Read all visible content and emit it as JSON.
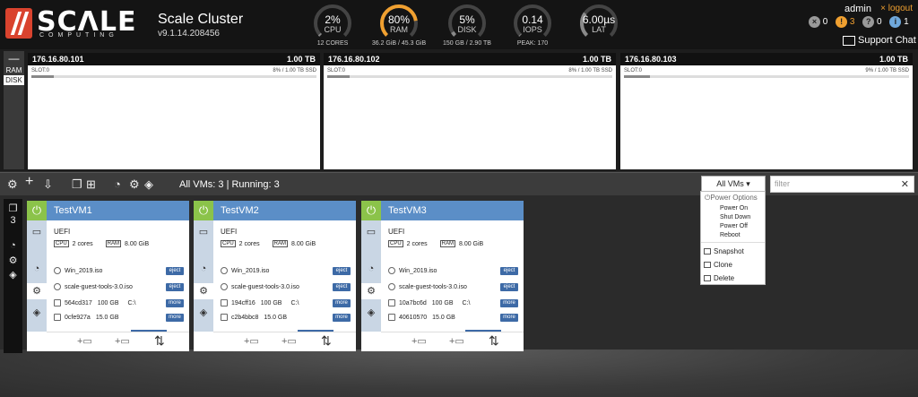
{
  "brand": {
    "word": "SCΛLE",
    "sub": "COMPUTING"
  },
  "cluster": {
    "name": "Scale Cluster",
    "version": "v9.1.14.208456"
  },
  "gauges": [
    {
      "value": "2%",
      "label": "CPU",
      "sub": "12 CORES",
      "fill": 0.02,
      "color": "#8a8a8a"
    },
    {
      "value": "80%",
      "label": "RAM",
      "sub": "36.2 GiB / 45.3 GiB",
      "fill": 0.8,
      "color": "#f0a030"
    },
    {
      "value": "5%",
      "label": "DISK",
      "sub": "150 GB / 2.90 TB",
      "fill": 0.05,
      "color": "#8a8a8a"
    },
    {
      "value": "0.14",
      "label": "IOPS",
      "sub": "PEAK: 170",
      "fill": 0.01,
      "color": "#8a8a8a"
    },
    {
      "value": "6.00µs",
      "label": "LAT",
      "sub": "",
      "fill": 0.3,
      "color": "#8a8a8a"
    }
  ],
  "user": {
    "name": "admin",
    "logout": "× logout"
  },
  "alerts": [
    {
      "icon": "error-icon",
      "count": "0",
      "color": "#999",
      "glyph": "×"
    },
    {
      "icon": "warning-icon",
      "count": "3",
      "color": "#f0a030",
      "glyph": "!"
    },
    {
      "icon": "question-icon",
      "count": "0",
      "color": "#999",
      "glyph": "?"
    },
    {
      "icon": "info-icon",
      "count": "1",
      "color": "#6fa8dc",
      "glyph": "i"
    }
  ],
  "support": "Support Chat",
  "rd": {
    "minimize": "—",
    "ram": "RAM",
    "disk": "DISK"
  },
  "nodes": [
    {
      "ip": "176.16.80.101",
      "capacity": "1.00 TB",
      "slot": "SLOT:0",
      "usage": "8% / 1.00 TB SSD",
      "fill": 0.08
    },
    {
      "ip": "176.16.80.102",
      "capacity": "1.00 TB",
      "slot": "SLOT:0",
      "usage": "8% / 1.00 TB SSD",
      "fill": 0.08
    },
    {
      "ip": "176.16.80.103",
      "capacity": "1.00 TB",
      "slot": "SLOT:0",
      "usage": "9% / 1.00 TB SSD",
      "fill": 0.09
    }
  ],
  "toolbar": {
    "vm_summary": "All VMs: 3 | Running: 3",
    "filter_select": "All VMs",
    "filter_placeholder": "filter"
  },
  "rail": {
    "count": "3"
  },
  "vms": [
    {
      "name": "TestVM1",
      "boot": "UEFI",
      "cores": "2 cores",
      "mem": "8.00 GiB",
      "iso1": "Win_2019.iso",
      "iso2": "scale-guest-tools-3.0.iso",
      "disk1_id": "564cd317",
      "disk1_size": "100 GB",
      "disk1_mount": "C:\\",
      "disk2_id": "0cfe927a",
      "disk2_size": "15.0 GB"
    },
    {
      "name": "TestVM2",
      "boot": "UEFI",
      "cores": "2 cores",
      "mem": "8.00 GiB",
      "iso1": "Win_2019.iso",
      "iso2": "scale-guest-tools-3.0.iso",
      "disk1_id": "194cff16",
      "disk1_size": "100 GB",
      "disk1_mount": "C:\\",
      "disk2_id": "c2b4bbc8",
      "disk2_size": "15.0 GB"
    },
    {
      "name": "TestVM3",
      "boot": "UEFI",
      "cores": "2 cores",
      "mem": "8.00 GiB",
      "iso1": "Win_2019.iso",
      "iso2": "scale-guest-tools-3.0.iso",
      "disk1_id": "10a7bc6d",
      "disk1_size": "100 GB",
      "disk1_mount": "C:\\",
      "disk2_id": "40610570",
      "disk2_size": "15.0 GB"
    }
  ],
  "vm_labels": {
    "cpu": "CPU",
    "ram": "RAM",
    "eject": "eject",
    "more": "more"
  },
  "dropdown": {
    "header": "Power Options",
    "power": [
      "Power On",
      "Shut Down",
      "Power Off",
      "Reboot"
    ],
    "snapshot": "Snapshot",
    "clone": "Clone",
    "delete": "Delete"
  }
}
